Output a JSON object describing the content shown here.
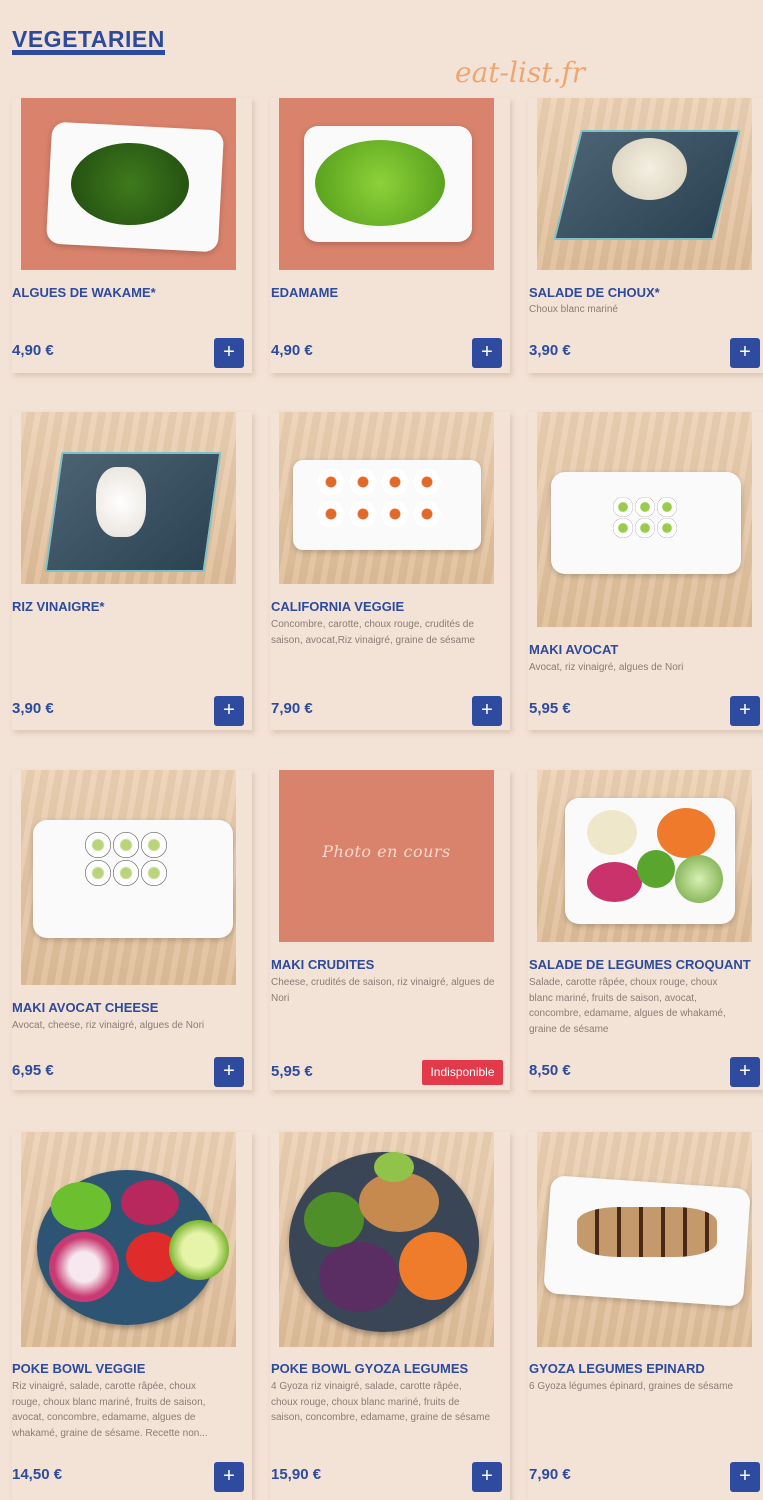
{
  "section": {
    "title": "VEGETARIEN",
    "watermark": "eat-list.fr"
  },
  "currency_note": "€",
  "placeholder_photo": "Photo en cours",
  "items": [
    {
      "name": "ALGUES DE WAKAME*",
      "desc": "",
      "price": "4,90 €",
      "button": "+",
      "status": ""
    },
    {
      "name": "EDAMAME",
      "desc": "",
      "price": "4,90 €",
      "button": "+",
      "status": ""
    },
    {
      "name": "SALADE DE CHOUX*",
      "desc": "Choux blanc mariné",
      "price": "3,90 €",
      "button": "+",
      "status": ""
    },
    {
      "name": "RIZ VINAIGRE*",
      "desc": "",
      "price": "3,90 €",
      "button": "+",
      "status": ""
    },
    {
      "name": "CALIFORNIA VEGGIE",
      "desc": "Concombre, carotte, choux rouge, crudités de saison, avocat,Riz vinaigré, graine de sésame",
      "price": "7,90 €",
      "button": "+",
      "status": ""
    },
    {
      "name": "MAKI AVOCAT",
      "desc": "Avocat, riz vinaigré, algues de Nori",
      "price": "5,95 €",
      "button": "+",
      "status": ""
    },
    {
      "name": "MAKI AVOCAT CHEESE",
      "desc": "Avocat, cheese, riz vinaigré, algues de Nori",
      "price": "6,95 €",
      "button": "+",
      "status": ""
    },
    {
      "name": "MAKI CRUDITES",
      "desc": "Cheese, crudités de saison, riz vinaigré, algues de Nori",
      "price": "5,95 €",
      "button": "",
      "status": "Indisponible"
    },
    {
      "name": "SALADE DE LEGUMES CROQUANT",
      "desc": "Salade, carotte râpée, choux rouge, choux blanc mariné, fruits de saison, avocat, concombre, edamame, algues de whakamé, graine de sésame",
      "price": "8,50 €",
      "button": "+",
      "status": ""
    },
    {
      "name": "POKE BOWL VEGGIE",
      "desc": "Riz vinaigré, salade, carotte râpée, choux rouge, choux blanc mariné, fruits de saison, avocat, concombre, edamame, algues de whakamé, graine de sésame. Recette non...",
      "price": "14,50 €",
      "button": "+",
      "status": ""
    },
    {
      "name": "POKE BOWL GYOZA LEGUMES",
      "desc": "4 Gyoza riz vinaigré, salade, carotte râpée, choux rouge, choux blanc mariné, fruits de saison, concombre, edamame, graine de sésame",
      "price": "15,90 €",
      "button": "+",
      "status": ""
    },
    {
      "name": "GYOZA LEGUMES EPINARD",
      "desc": "6 Gyoza légumes épinard, graines de sésame",
      "price": "7,90 €",
      "button": "+",
      "status": ""
    }
  ],
  "colors": {
    "brand": "#2f4b9f",
    "background": "#f3e2d6",
    "unavailable": "#e23a4a",
    "accent_watermark": "#f0a36b"
  }
}
